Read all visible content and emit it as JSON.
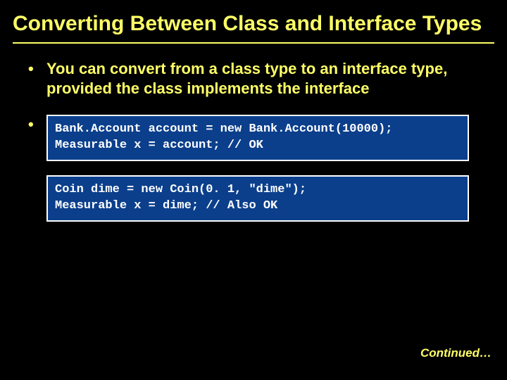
{
  "title": "Converting Between Class and Interface Types",
  "bullets": {
    "b1": "You can convert from a class type to an interface type, provided the class implements the interface"
  },
  "code": {
    "block1": "Bank.Account account = new Bank.Account(10000);\nMeasurable x = account; // OK",
    "block2": "Coin dime = new Coin(0. 1, \"dime\");\nMeasurable x = dime; // Also OK"
  },
  "footer": {
    "continued": "Continued…"
  }
}
